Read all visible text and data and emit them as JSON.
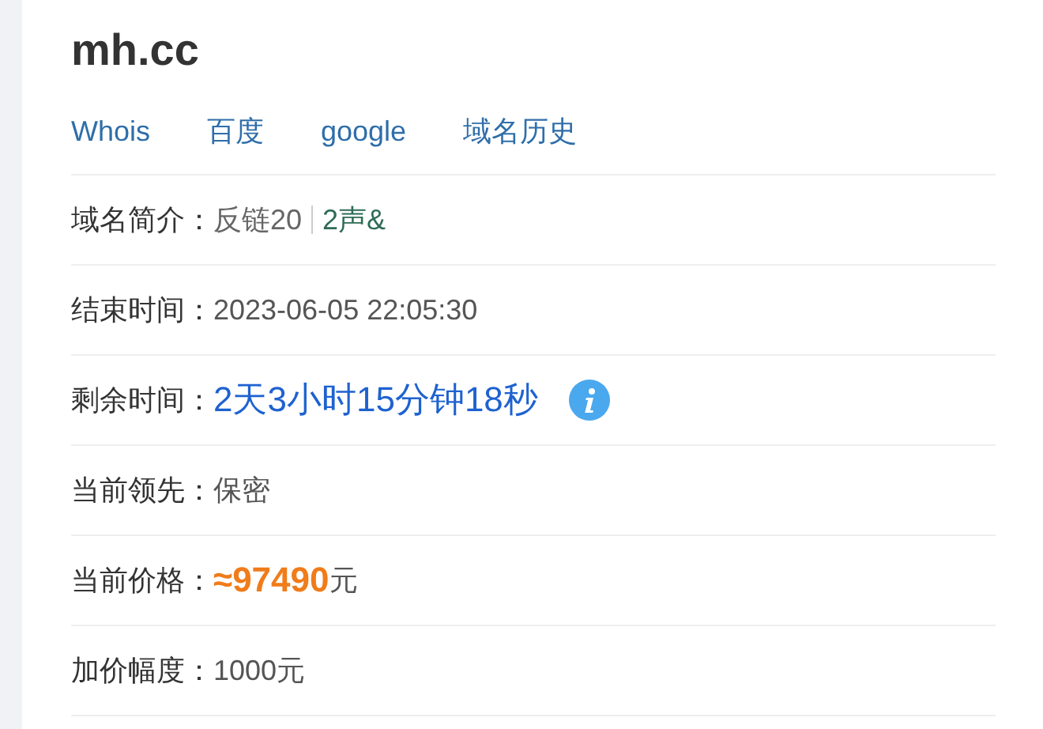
{
  "domain": "mh.cc",
  "links": [
    "Whois",
    "百度",
    "google",
    "域名历史"
  ],
  "rows": [
    {
      "kind": "tags",
      "label": "域名简介：",
      "tags": [
        {
          "text": "反链20",
          "color": "#666666"
        },
        {
          "text": "2声&",
          "color": "#2e6b55"
        }
      ]
    },
    {
      "kind": "text",
      "label": "结束时间：",
      "value": "2023-06-05 22:05:30"
    },
    {
      "kind": "countdown",
      "label": "剩余时间：",
      "value": "2天3小时15分钟18秒"
    },
    {
      "kind": "text",
      "label": "当前领先：",
      "value": "保密"
    },
    {
      "kind": "price",
      "label": "当前价格：",
      "value": "≈97490",
      "unit": "元"
    },
    {
      "kind": "text",
      "label": "加价幅度：",
      "value": "1000元"
    }
  ]
}
